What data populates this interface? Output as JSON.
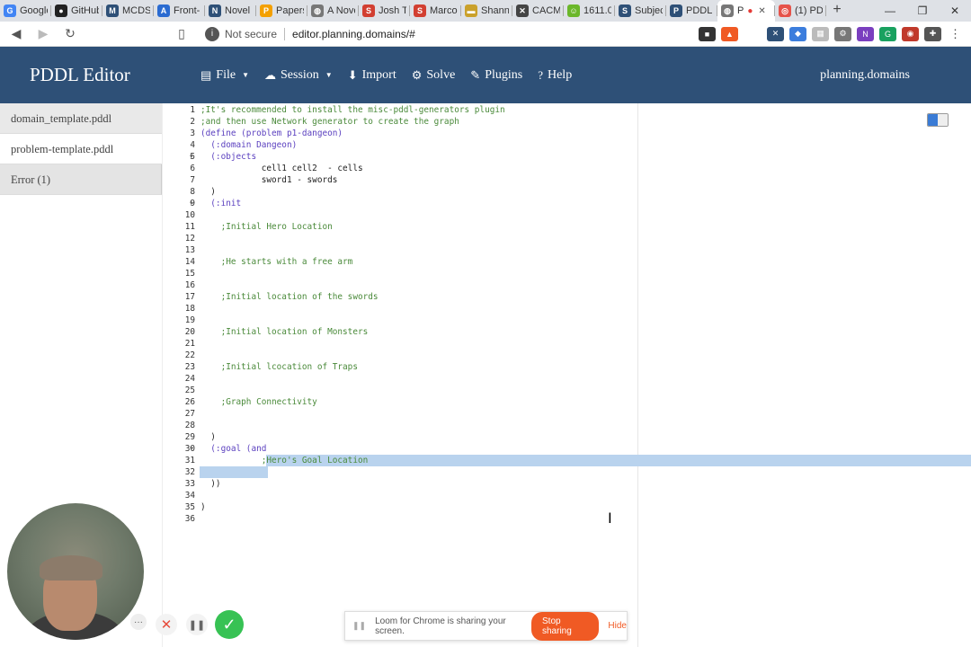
{
  "browser": {
    "tabs": [
      {
        "label": "Google",
        "icon": "google-icon",
        "color": "#4285f4",
        "glyph": "G"
      },
      {
        "label": "GitHub",
        "icon": "github-icon",
        "color": "#222222",
        "glyph": "●"
      },
      {
        "label": "MCDS",
        "icon": "mcds-icon",
        "color": "#2e5077",
        "glyph": "M"
      },
      {
        "label": "Front-",
        "icon": "front-icon",
        "color": "#2a6bd1",
        "glyph": "A"
      },
      {
        "label": "Novel",
        "icon": "novel-icon",
        "color": "#2e5077",
        "glyph": "N"
      },
      {
        "label": "Papers",
        "icon": "papers-icon",
        "color": "#f4a000",
        "glyph": "P"
      },
      {
        "label": "A Nove",
        "icon": "globe-icon",
        "color": "#777777",
        "glyph": "◍"
      },
      {
        "label": "Josh Te",
        "icon": "s-icon",
        "color": "#d23f31",
        "glyph": "S"
      },
      {
        "label": "Marco",
        "icon": "s-icon",
        "color": "#d23f31",
        "glyph": "S"
      },
      {
        "label": "Shanno",
        "icon": "shannon-icon",
        "color": "#caa12b",
        "glyph": "▬"
      },
      {
        "label": "CACM",
        "icon": "cacm-icon",
        "color": "#444444",
        "glyph": "✕"
      },
      {
        "label": "1611.0",
        "icon": "arxiv-icon",
        "color": "#6bb72a",
        "glyph": "☺"
      },
      {
        "label": "Subject",
        "icon": "subject-icon",
        "color": "#2e5077",
        "glyph": "S"
      },
      {
        "label": "PDDL E",
        "icon": "pddl-icon",
        "color": "#2e5077",
        "glyph": "P"
      },
      {
        "label": "P",
        "icon": "globe-icon",
        "color": "#777777",
        "glyph": "◍",
        "active": true
      },
      {
        "label": "(1) PD",
        "icon": "loom-icon",
        "color": "#e6534a",
        "glyph": "◎"
      }
    ],
    "new_tab": "+",
    "not_secure": "Not secure",
    "url": "editor.planning.domains/#"
  },
  "navbar": {
    "brand": "PDDL Editor",
    "menu": [
      {
        "icon": "file-icon",
        "glyph": "▤",
        "label": "File",
        "caret": true
      },
      {
        "icon": "cloud-icon",
        "glyph": "☁",
        "label": "Session",
        "caret": true
      },
      {
        "icon": "import-icon",
        "glyph": "⬇",
        "label": "Import",
        "caret": false
      },
      {
        "icon": "gear-icon",
        "glyph": "⚙",
        "label": "Solve",
        "caret": false
      },
      {
        "icon": "wrench-icon",
        "glyph": "✎",
        "label": "Plugins",
        "caret": false
      },
      {
        "icon": "help-icon",
        "glyph": "?",
        "label": "Help",
        "caret": false
      }
    ],
    "right": "planning.domains"
  },
  "sidebar": {
    "files": [
      {
        "label": "domain_template.pddl",
        "state": "normal"
      },
      {
        "label": "problem-template.pddl",
        "state": "active"
      },
      {
        "label": "Error (1)",
        "state": "error"
      }
    ]
  },
  "editor": {
    "lines": [
      {
        "n": "1",
        "t": ";It's recommended to install the misc-pddl-generators plugin",
        "c": "cm"
      },
      {
        "n": "2",
        "t": ";and then use Network generator to create the graph",
        "c": "cm"
      },
      {
        "n": "3",
        "t": "(define (problem p1-dangeon)",
        "c": "mix1"
      },
      {
        "n": "4",
        "t": "  (:domain Dangeon)",
        "c": "mix2"
      },
      {
        "n": "5",
        "t": "  (:objects",
        "c": "kw",
        "fold": true
      },
      {
        "n": "6",
        "t": "            cell1 cell2  - cells",
        "c": ""
      },
      {
        "n": "7",
        "t": "            sword1 - swords",
        "c": ""
      },
      {
        "n": "8",
        "t": "  )",
        "c": ""
      },
      {
        "n": "9",
        "t": "  (:init",
        "c": "kw",
        "fold": true
      },
      {
        "n": "10",
        "t": "",
        "c": ""
      },
      {
        "n": "11",
        "t": "    ;Initial Hero Location",
        "c": "cm"
      },
      {
        "n": "12",
        "t": "",
        "c": ""
      },
      {
        "n": "13",
        "t": "",
        "c": ""
      },
      {
        "n": "14",
        "t": "    ;He starts with a free arm",
        "c": "cm"
      },
      {
        "n": "15",
        "t": "",
        "c": ""
      },
      {
        "n": "16",
        "t": "",
        "c": ""
      },
      {
        "n": "17",
        "t": "    ;Initial location of the swords",
        "c": "cm"
      },
      {
        "n": "18",
        "t": "",
        "c": ""
      },
      {
        "n": "19",
        "t": "",
        "c": ""
      },
      {
        "n": "20",
        "t": "    ;Initial location of Monsters",
        "c": "cm"
      },
      {
        "n": "21",
        "t": "",
        "c": ""
      },
      {
        "n": "22",
        "t": "",
        "c": ""
      },
      {
        "n": "23",
        "t": "    ;Initial lcocation of Traps",
        "c": "cm"
      },
      {
        "n": "24",
        "t": "",
        "c": ""
      },
      {
        "n": "25",
        "t": "",
        "c": ""
      },
      {
        "n": "26",
        "t": "    ;Graph Connectivity",
        "c": "cm"
      },
      {
        "n": "27",
        "t": "",
        "c": ""
      },
      {
        "n": "28",
        "t": "",
        "c": ""
      },
      {
        "n": "29",
        "t": "  )",
        "c": ""
      },
      {
        "n": "30",
        "t": "  (:goal (and",
        "c": "goal",
        "fold": true
      },
      {
        "n": "31",
        "t": "            ;Hero's Goal Location",
        "c": "cm"
      },
      {
        "n": "32",
        "t": "",
        "c": ""
      },
      {
        "n": "33",
        "t": "  ))",
        "c": ""
      },
      {
        "n": "34",
        "t": "",
        "c": ""
      },
      {
        "n": "35",
        "t": ")",
        "c": ""
      },
      {
        "n": "36",
        "t": "",
        "c": ""
      }
    ],
    "selected_lines": [
      "31",
      "32"
    ]
  },
  "loom": {
    "message": "Loom for Chrome is sharing your screen.",
    "stop": "Stop sharing",
    "hide": "Hide"
  },
  "colors": {
    "navbar": "#2e5077",
    "selection": "#b9d3ee",
    "comment": "#4a8a3a",
    "keyword": "#5a3fbf",
    "loom_accent": "#f05a24",
    "loom_done": "#37c254"
  }
}
